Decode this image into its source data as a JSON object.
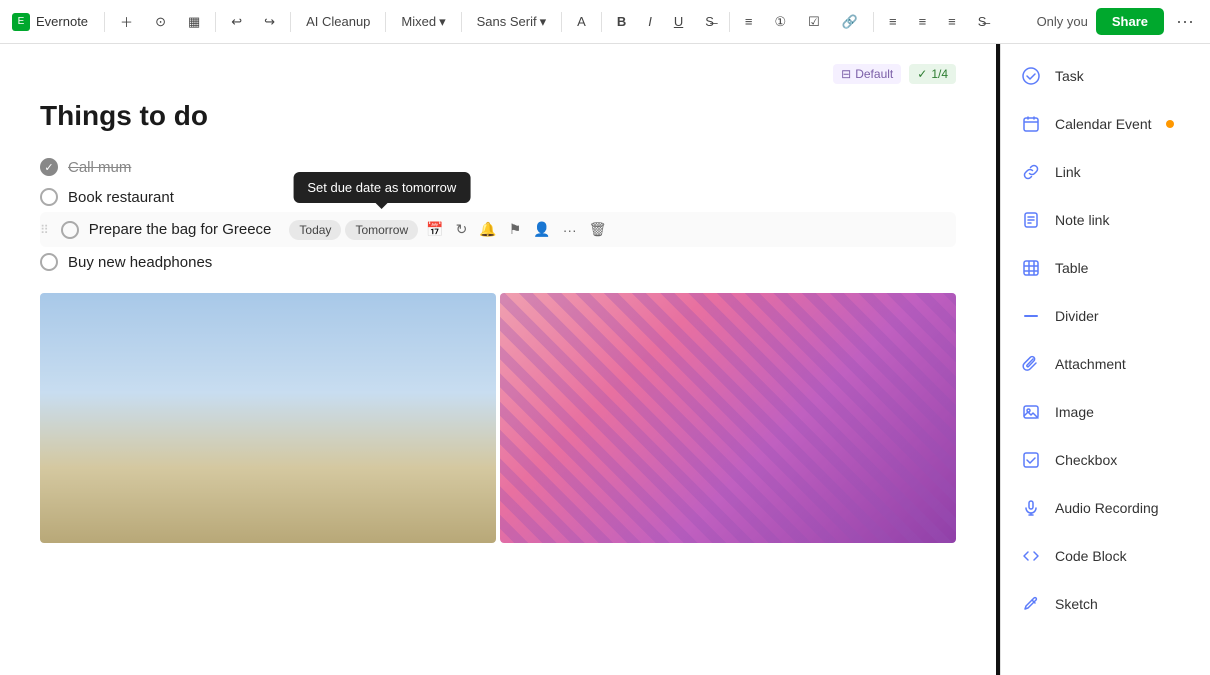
{
  "app": {
    "name": "Evernote",
    "visibility": "Only you",
    "share_label": "Share"
  },
  "toolbar": {
    "ai_cleanup": "AI Cleanup",
    "font_style": "Mixed",
    "font_face": "Sans Serif",
    "bold": "B",
    "italic": "I",
    "underline": "U"
  },
  "editor": {
    "default_label": "Default",
    "count_label": "1/4",
    "page_title": "Things to do",
    "tasks": [
      {
        "text": "Call mum",
        "done": true
      },
      {
        "text": "Book restaurant",
        "done": false
      },
      {
        "text": "Prepare the bag for Greece",
        "done": false,
        "active": true
      },
      {
        "text": "Buy new headphones",
        "done": false
      }
    ],
    "task_tools": {
      "today": "Today",
      "tomorrow": "Tomorrow"
    },
    "tooltip": "Set due date as tomorrow"
  },
  "right_panel": {
    "items": [
      {
        "icon": "✓",
        "label": "Task",
        "icon_type": "blue"
      },
      {
        "icon": "📅",
        "label": "Calendar Event",
        "icon_type": "blue",
        "badge": true
      },
      {
        "icon": "🔗",
        "label": "Link",
        "icon_type": "blue"
      },
      {
        "icon": "📄",
        "label": "Note link",
        "icon_type": "blue"
      },
      {
        "icon": "⊞",
        "label": "Table",
        "icon_type": "blue"
      },
      {
        "icon": "—",
        "label": "Divider",
        "icon_type": "blue"
      },
      {
        "icon": "📎",
        "label": "Attachment",
        "icon_type": "blue"
      },
      {
        "icon": "🖼",
        "label": "Image",
        "icon_type": "blue"
      },
      {
        "icon": "☒",
        "label": "Checkbox",
        "icon_type": "blue"
      },
      {
        "icon": "🎙",
        "label": "Audio Recording",
        "icon_type": "blue"
      },
      {
        "icon": "{}",
        "label": "Code Block",
        "icon_type": "blue"
      },
      {
        "icon": "✏",
        "label": "Sketch",
        "icon_type": "blue"
      }
    ]
  }
}
